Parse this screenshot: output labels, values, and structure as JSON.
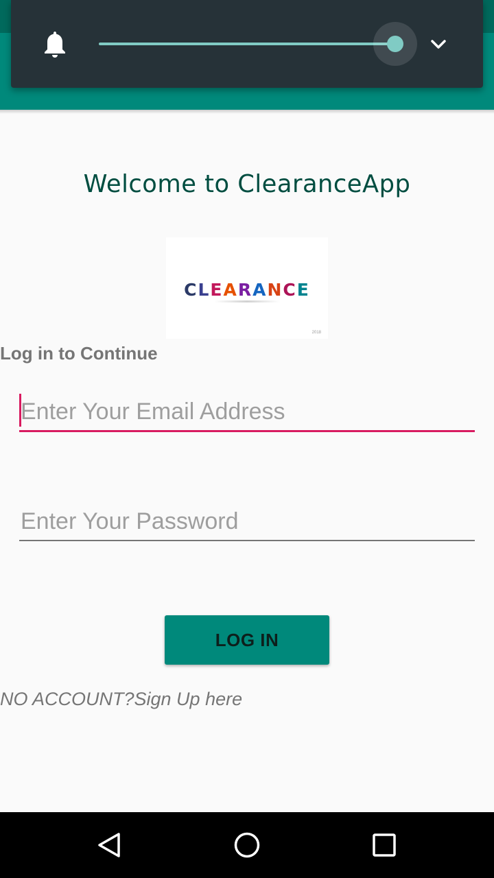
{
  "volume_panel": {
    "level": 1.0,
    "icons": {
      "bell": "bell-icon",
      "expand": "chevron-down-icon"
    },
    "accent_color": "#80cbc4"
  },
  "colors": {
    "primary": "#00897b",
    "primary_dark": "#00695c",
    "accent": "#d81b60"
  },
  "welcome": {
    "text": "Welcome to ClearanceApp"
  },
  "logo": {
    "text": "CLEARANCE",
    "letters": [
      "C",
      "L",
      "E",
      "A",
      "R",
      "A",
      "N",
      "C",
      "E"
    ],
    "small_text": "2018"
  },
  "login": {
    "heading": "Log in to Continue",
    "email_placeholder": "Enter Your Email Address",
    "email_value": "",
    "password_placeholder": "Enter Your Password",
    "password_value": "",
    "button_label": "LOG IN",
    "signup_text": "NO ACCOUNT?Sign Up here"
  },
  "nav": {
    "back": "back-icon",
    "home": "home-icon",
    "recents": "recents-icon"
  }
}
